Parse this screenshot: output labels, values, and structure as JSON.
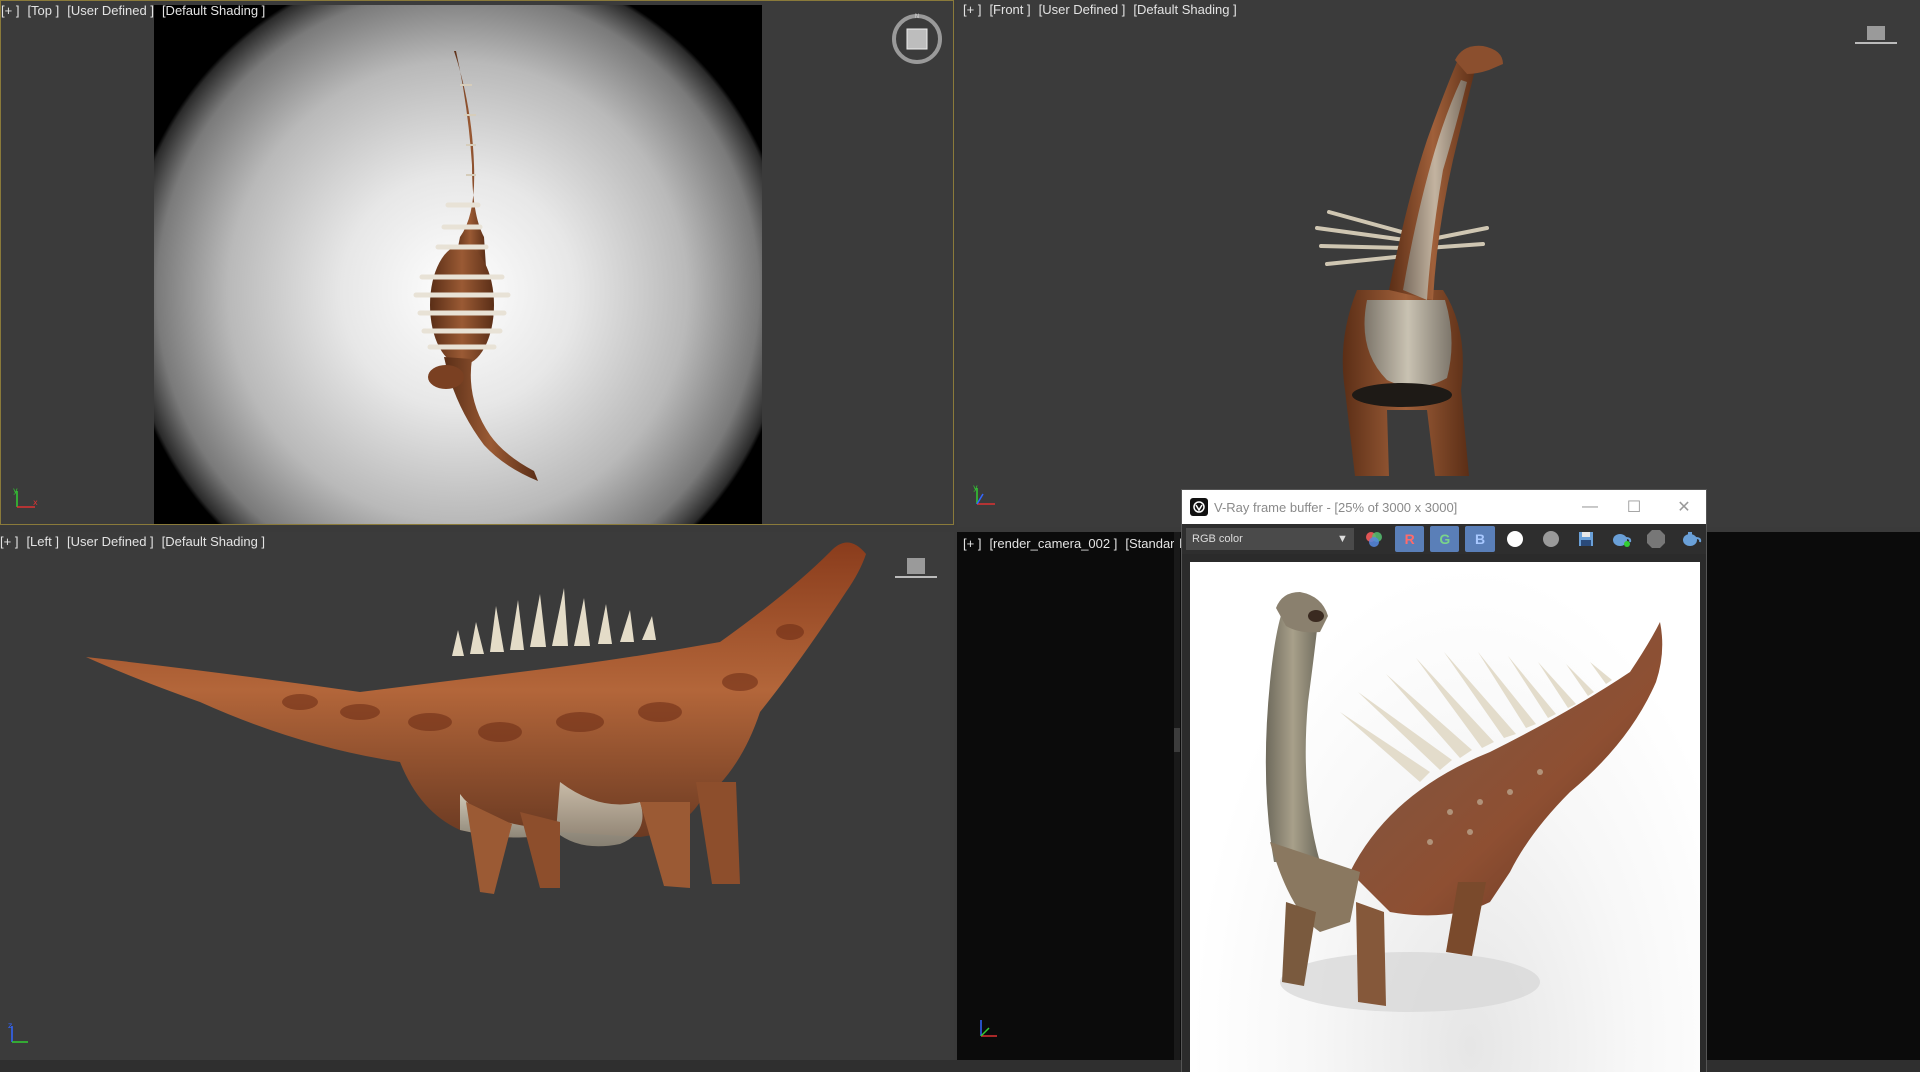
{
  "viewports": {
    "top": {
      "plus": "[+ ]",
      "view": "[Top ]",
      "mode": "[User Defined ]",
      "shading": "[Default Shading ]"
    },
    "front": {
      "plus": "[+ ]",
      "view": "[Front ]",
      "mode": "[User Defined ]",
      "shading": "[Default Shading ]"
    },
    "left": {
      "plus": "[+ ]",
      "view": "[Left ]",
      "mode": "[User Defined ]",
      "shading": "[Default Shading ]"
    },
    "camera": {
      "plus": "[+ ]",
      "view": "[render_camera_002 ]",
      "shading": "[Standard"
    }
  },
  "vfb": {
    "title": "V-Ray frame buffer - [25% of 3000 x 3000]",
    "channel": "RGB color",
    "r_label": "R",
    "g_label": "G",
    "b_label": "B",
    "minimize": "—",
    "maximize": "☐",
    "close": "✕"
  },
  "icons": {
    "viewcube": "viewcube-icon",
    "axis": "axis-tripod-icon",
    "vray_logo": "vray-logo-icon",
    "dropdown": "chevron-down-icon"
  },
  "colors": {
    "viewport_bg": "#3b3b3b",
    "active_border": "#8a7a3a",
    "camera_bg": "#0b0b0b",
    "dino_brown": "#8a4a2a",
    "dino_belly": "#b8ad9a"
  }
}
